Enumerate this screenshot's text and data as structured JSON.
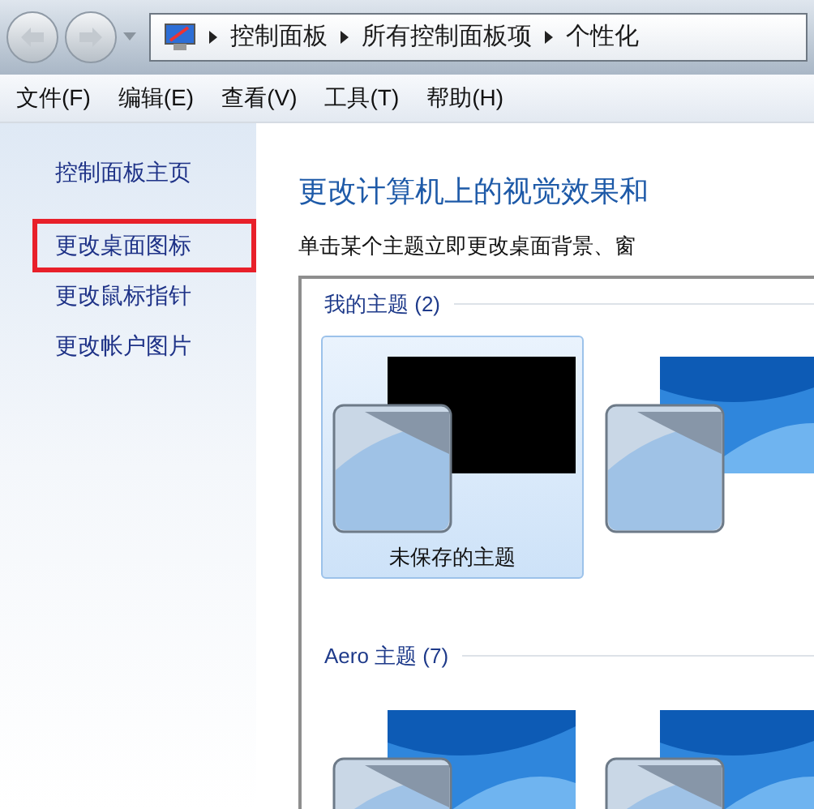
{
  "address_bar": {
    "breadcrumbs": [
      "控制面板",
      "所有控制面板项",
      "个性化"
    ]
  },
  "menu": [
    "文件(F)",
    "编辑(E)",
    "查看(V)",
    "工具(T)",
    "帮助(H)"
  ],
  "sidebar": {
    "items": [
      {
        "label": "控制面板主页",
        "highlighted": false
      },
      {
        "label": "更改桌面图标",
        "highlighted": true
      },
      {
        "label": "更改鼠标指针",
        "highlighted": false
      },
      {
        "label": "更改帐户图片",
        "highlighted": false
      }
    ]
  },
  "content": {
    "heading": "更改计算机上的视觉效果和",
    "description": "单击某个主题立即更改桌面背景、窗",
    "groups": [
      {
        "title": "我的主题 (2)",
        "themes": [
          {
            "kind": "dark",
            "name": "未保存的主题",
            "selected": true
          },
          {
            "kind": "aero",
            "selected": false
          }
        ]
      },
      {
        "title": "Aero 主题 (7)",
        "themes": [
          {
            "kind": "aero",
            "selected": false
          },
          {
            "kind": "aero",
            "selected": false
          }
        ]
      }
    ]
  }
}
